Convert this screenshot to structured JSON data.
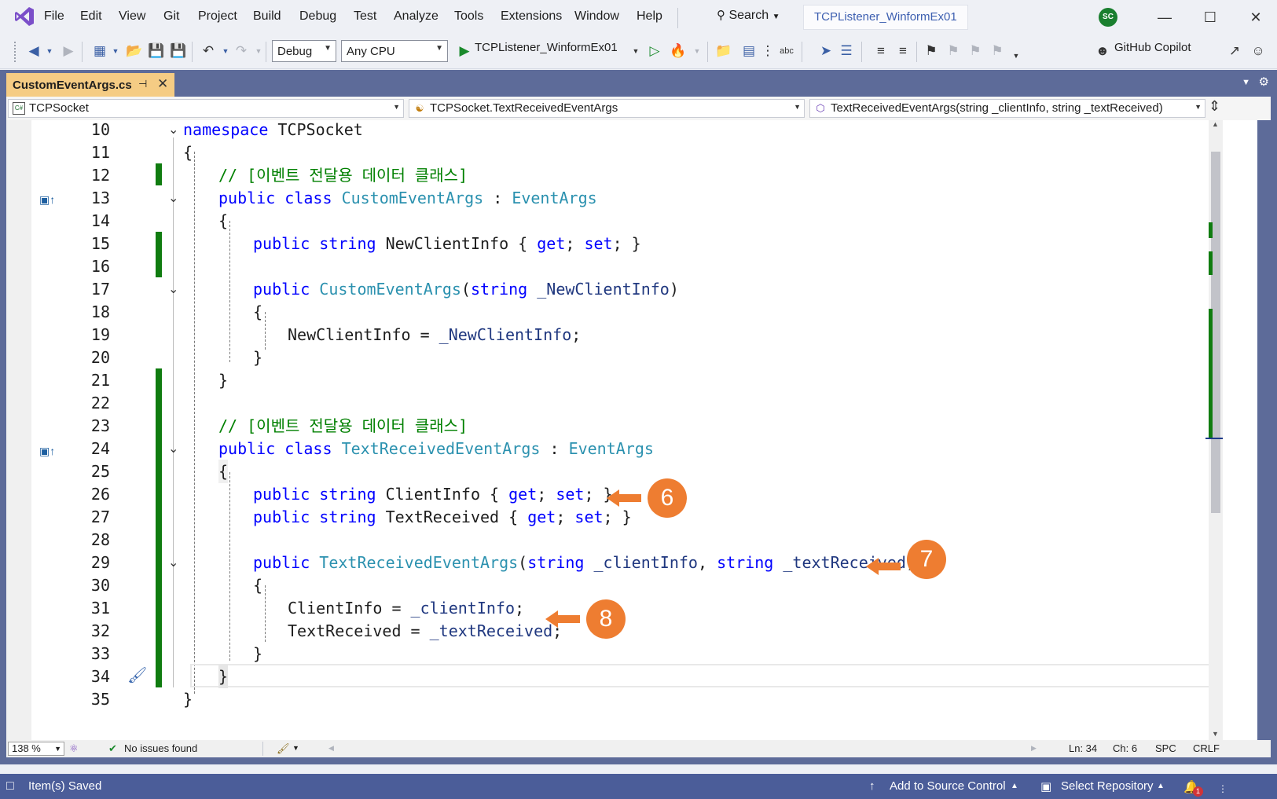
{
  "menu": [
    "File",
    "Edit",
    "View",
    "Git",
    "Project",
    "Build",
    "Debug",
    "Test",
    "Analyze",
    "Tools",
    "Extensions",
    "Window",
    "Help"
  ],
  "search": {
    "label": "Search"
  },
  "solution_name": "TCPListener_WinformEx01",
  "user_initials": "SC",
  "toolbar": {
    "configuration": "Debug",
    "platform": "Any CPU",
    "startup_project": "TCPListener_WinformEx01",
    "copilot_label": "GitHub Copilot"
  },
  "document_tab": {
    "title": "CustomEventArgs.cs",
    "pin_glyph": "⊣",
    "close_glyph": "✕"
  },
  "navbar": {
    "project": "TCPSocket",
    "type": "TCPSocket.TextReceivedEventArgs",
    "member": "TextReceivedEventArgs(string _clientInfo, string _textReceived)"
  },
  "code_lines": [
    {
      "n": "10",
      "text": "namespace TCPSocket"
    },
    {
      "n": "11",
      "text": "{"
    },
    {
      "n": "12",
      "text": "// [이벤트 전달용 데이터 클래스]"
    },
    {
      "n": "13",
      "text": "public class CustomEventArgs : EventArgs"
    },
    {
      "n": "14",
      "text": "{"
    },
    {
      "n": "15",
      "text": "public string NewClientInfo { get; set; }"
    },
    {
      "n": "16",
      "text": ""
    },
    {
      "n": "17",
      "text": "public CustomEventArgs(string _NewClientInfo)"
    },
    {
      "n": "18",
      "text": "{"
    },
    {
      "n": "19",
      "text": "NewClientInfo = _NewClientInfo;"
    },
    {
      "n": "20",
      "text": "}"
    },
    {
      "n": "21",
      "text": "}"
    },
    {
      "n": "22",
      "text": ""
    },
    {
      "n": "23",
      "text": "// [이벤트 전달용 데이터 클래스]"
    },
    {
      "n": "24",
      "text": "public class TextReceivedEventArgs : EventArgs"
    },
    {
      "n": "25",
      "text": "{"
    },
    {
      "n": "26",
      "text": "public string ClientInfo { get; set; }"
    },
    {
      "n": "27",
      "text": "public string TextReceived { get; set; }"
    },
    {
      "n": "28",
      "text": ""
    },
    {
      "n": "29",
      "text": "public TextReceivedEventArgs(string _clientInfo, string _textReceived)"
    },
    {
      "n": "30",
      "text": "{"
    },
    {
      "n": "31",
      "text": "ClientInfo = _clientInfo;"
    },
    {
      "n": "32",
      "text": "TextReceived = _textReceived;"
    },
    {
      "n": "33",
      "text": "}"
    },
    {
      "n": "34",
      "text": "}"
    },
    {
      "n": "35",
      "text": "}"
    }
  ],
  "annotations": {
    "a6": "6",
    "a7": "7",
    "a8": "8"
  },
  "editor_status": {
    "zoom": "138 %",
    "issues": "No issues found",
    "line": "Ln: 34",
    "col": "Ch: 6",
    "whitespace": "SPC",
    "line_ending": "CRLF"
  },
  "statusbar": {
    "message": "Item(s) Saved",
    "source_control": "Add to Source Control",
    "repository": "Select Repository",
    "notifications_count": "1"
  },
  "colors": {
    "accent_orange": "#ee7d31",
    "change_bar_green": "#107c10",
    "statusbar_bg": "#4b5d99",
    "doc_area_bg": "#5d6b99",
    "tab_active_bg": "#f5cc84"
  }
}
